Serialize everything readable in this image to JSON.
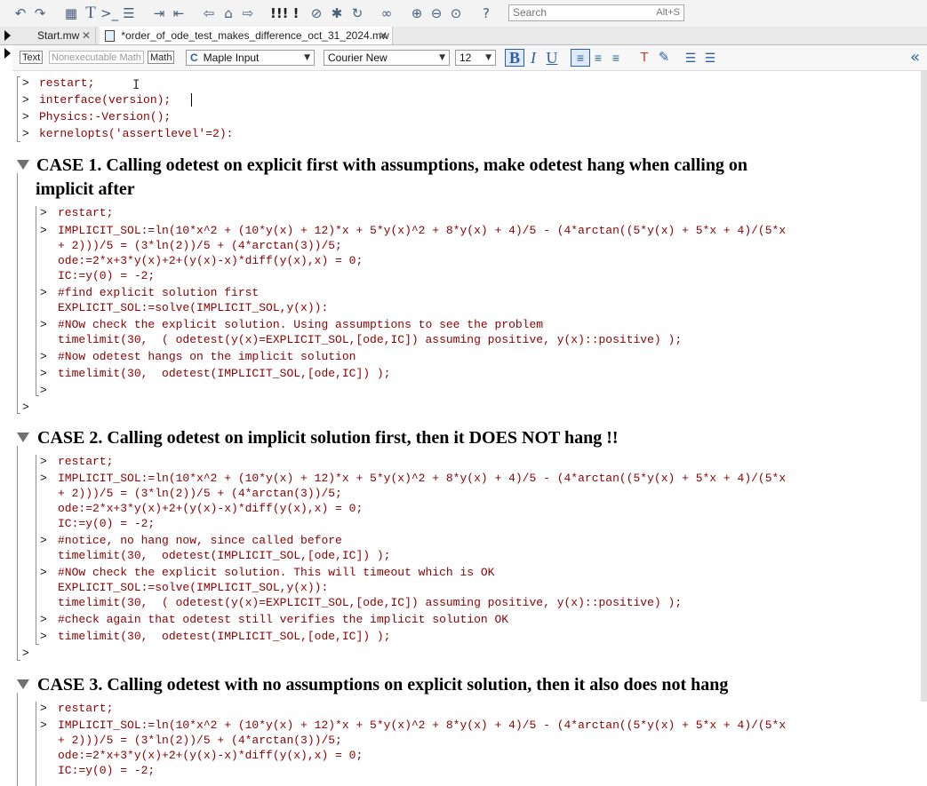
{
  "toolbar": {
    "icons": [
      "undo-icon",
      "redo-icon",
      "text-region-icon",
      "text-icon",
      "math-prompt-icon",
      "execution-group-icon",
      "indent-icon",
      "outdent-icon",
      "back-icon",
      "home-icon",
      "forward-icon",
      "execute-all-icon",
      "execute-icon",
      "stop-icon",
      "debug-icon",
      "restart-icon",
      "link-icon",
      "zoom-in-icon",
      "zoom-out-icon",
      "zoom-reset-icon",
      "help-icon"
    ],
    "search_placeholder": "Search",
    "search_shortcut": "Alt+S"
  },
  "tabs": [
    {
      "label": "Start.mw",
      "active": false
    },
    {
      "label": "*order_of_ode_test_makes_difference_oct_31_2024.mw",
      "active": true
    }
  ],
  "format_bar": {
    "text_btn": "Text",
    "nonexec_btn": "Nonexecutable Math",
    "math_btn": "Math",
    "input_mode": "Maple Input",
    "font": "Courier New",
    "size": "12",
    "bold": "B",
    "italic": "I",
    "underline": "U"
  },
  "doc": {
    "top_lines": [
      "restart;",
      "interface(version);",
      "Physics:-Version();",
      "kernelopts('assertlevel'=2):"
    ],
    "case1": {
      "heading_line1": "CASE 1. Calling odetest on explicit first with assumptions, make odetest hang when calling on",
      "heading_line2": "implicit after",
      "lines": [
        "restart;",
        "IMPLICIT_SOL:=ln(10*x^2 + (10*y(x) + 12)*x + 5*y(x)^2 + 8*y(x) + 4)/5 - (4*arctan((5*y(x) + 5*x + 4)/(5*x",
        "+ 2)))/5 = (3*ln(2))/5 + (4*arctan(3))/5;",
        "ode:=2*x+3*y(x)+2+(y(x)-x)*diff(y(x),x) = 0;",
        "IC:=y(0) = -2;",
        "#find explicit solution first",
        "EXPLICIT_SOL:=solve(IMPLICIT_SOL,y(x)):",
        "#NOw check the explicit solution. Using assumptions to see the problem",
        "timelimit(30,  ( odetest(y(x)=EXPLICIT_SOL,[ode,IC]) assuming positive, y(x)::positive) );",
        "#Now odetest hangs on the implicit solution",
        "timelimit(30,  odetest(IMPLICIT_SOL,[ode,IC]) );"
      ]
    },
    "case2": {
      "heading": "CASE 2. Calling odetest on implicit solution first, then it DOES NOT hang !!",
      "lines": [
        "restart;",
        "IMPLICIT_SOL:=ln(10*x^2 + (10*y(x) + 12)*x + 5*y(x)^2 + 8*y(x) + 4)/5 - (4*arctan((5*y(x) + 5*x + 4)/(5*x",
        "+ 2)))/5 = (3*ln(2))/5 + (4*arctan(3))/5;",
        "ode:=2*x+3*y(x)+2+(y(x)-x)*diff(y(x),x) = 0;",
        "IC:=y(0) = -2;",
        "#notice, no hang now, since called before",
        "timelimit(30,  odetest(IMPLICIT_SOL,[ode,IC]) );",
        "#NOw check the explicit solution. This will timeout which is OK",
        "EXPLICIT_SOL:=solve(IMPLICIT_SOL,y(x)):",
        "timelimit(30,  ( odetest(y(x)=EXPLICIT_SOL,[ode,IC]) assuming positive, y(x)::positive) );",
        "#check again that odetest still verifies the implicit solution OK",
        "timelimit(30,  odetest(IMPLICIT_SOL,[ode,IC]) );"
      ]
    },
    "case3": {
      "heading": "CASE 3. Calling odetest with no assumptions on explicit solution, then it also does not hang",
      "lines": [
        "restart;",
        "IMPLICIT_SOL:=ln(10*x^2 + (10*y(x) + 12)*x + 5*y(x)^2 + 8*y(x) + 4)/5 - (4*arctan((5*y(x) + 5*x + 4)/(5*x",
        "+ 2)))/5 = (3*ln(2))/5 + (4*arctan(3))/5;",
        "ode:=2*x+3*y(x)+2+(y(x)-x)*diff(y(x),x) = 0;",
        "IC:=y(0) = -2;"
      ]
    },
    "prompt": ">"
  }
}
